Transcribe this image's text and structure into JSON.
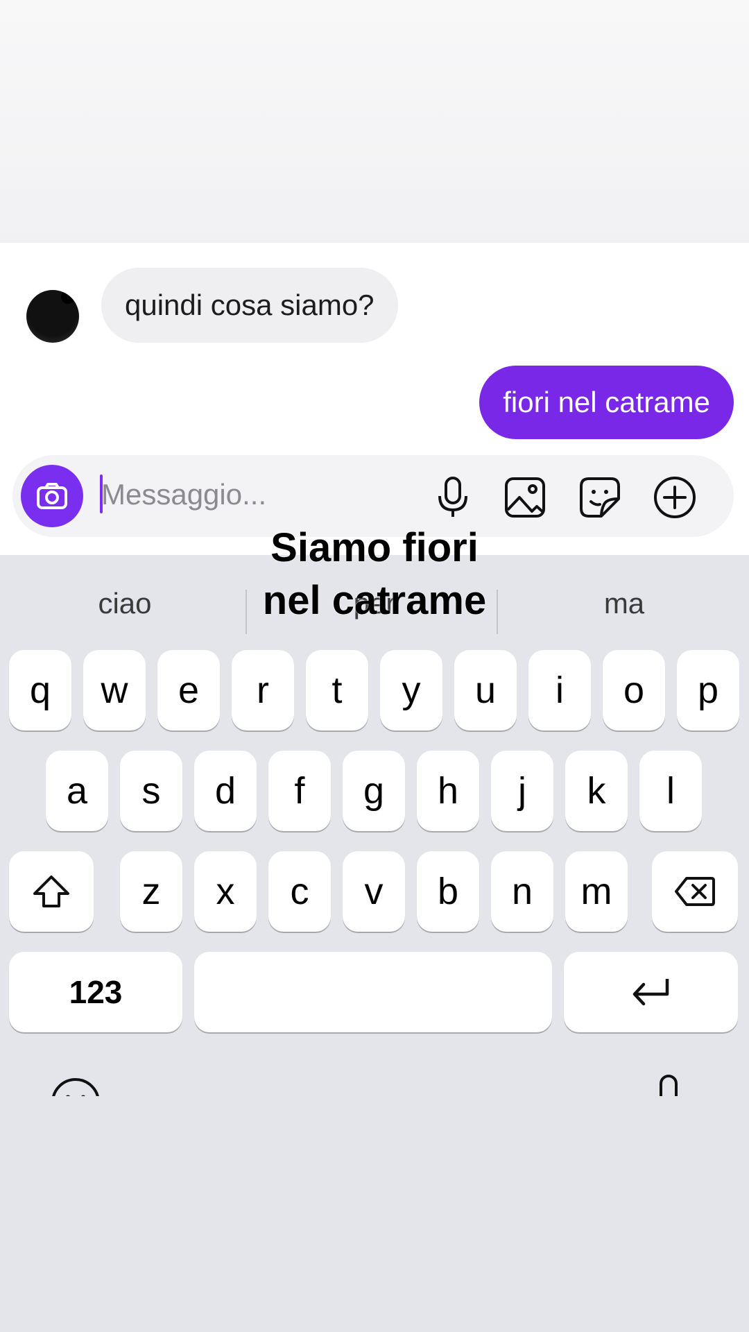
{
  "chat": {
    "incoming_message": "quindi cosa siamo?",
    "outgoing_message": "fiori nel catrame"
  },
  "composer": {
    "placeholder": "Messaggio...",
    "icons": [
      "camera-icon",
      "microphone-icon",
      "gallery-icon",
      "sticker-icon",
      "plus-icon"
    ]
  },
  "overlay": {
    "caption": "Siamo fiori\nnel catrame"
  },
  "keyboard": {
    "suggestions": [
      "ciao",
      "per",
      "ma"
    ],
    "row1": [
      "q",
      "w",
      "e",
      "r",
      "t",
      "y",
      "u",
      "i",
      "o",
      "p"
    ],
    "row2": [
      "a",
      "s",
      "d",
      "f",
      "g",
      "h",
      "j",
      "k",
      "l"
    ],
    "row3": [
      "z",
      "x",
      "c",
      "v",
      "b",
      "n",
      "m"
    ],
    "numbers_label": "123",
    "icons": [
      "shift-icon",
      "backspace-icon",
      "return-icon",
      "emoji-icon",
      "dictation-icon"
    ]
  },
  "colors": {
    "accent": "#7928e8",
    "keyboard_bg": "#e4e5ea",
    "incoming_bubble": "#efeff2"
  }
}
